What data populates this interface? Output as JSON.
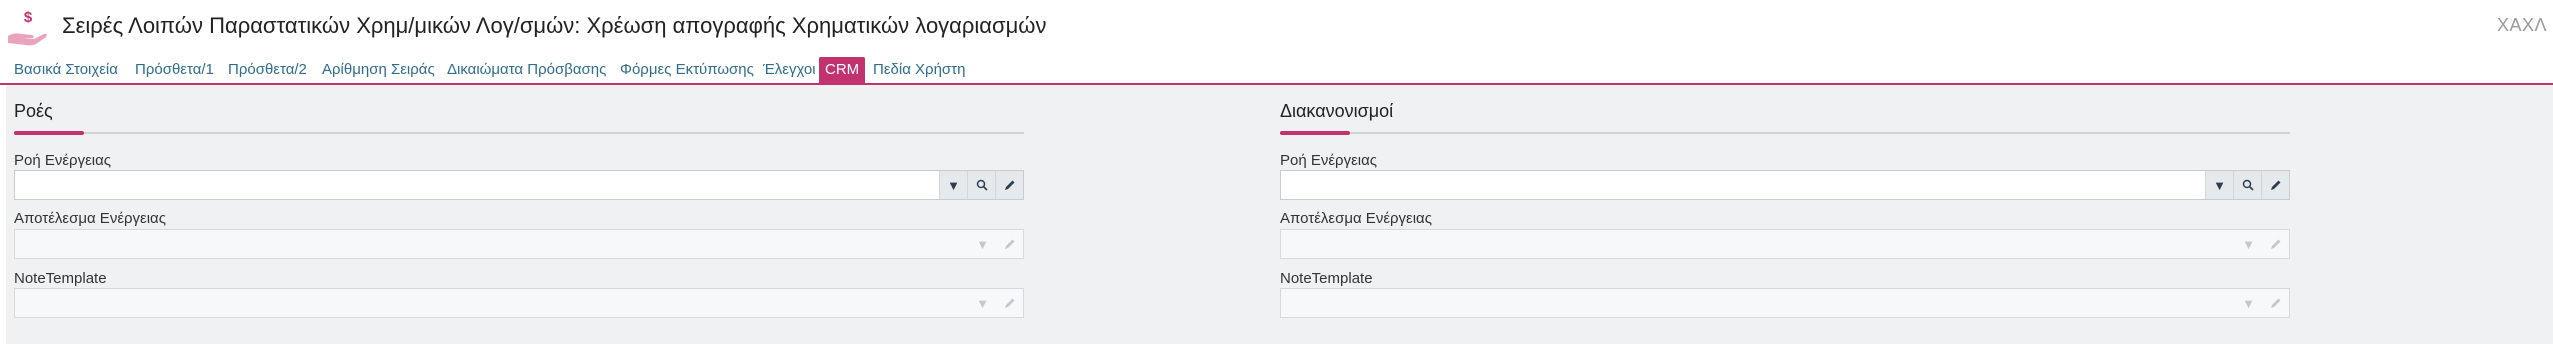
{
  "header": {
    "title": "Σειρές Λοιπών Παραστατικών Χρημ/μικών Λογ/σμών: Χρέωση απογραφής Χρηματικών λογαριασμών",
    "code": "ΧΑΧΛ",
    "icon": "money-hand-icon"
  },
  "tabs": [
    {
      "label": "Βασικά Στοιχεία"
    },
    {
      "label": "Πρόσθετα/1"
    },
    {
      "label": "Πρόσθετα/2"
    },
    {
      "label": "Αρίθμηση Σειράς"
    },
    {
      "label": "Δικαιώματα Πρόσβασης"
    },
    {
      "label": "Φόρμες Εκτύπωσης"
    },
    {
      "label": "Έλεγχοι"
    },
    {
      "label": "CRM",
      "active": true
    },
    {
      "label": "Πεδία Χρήστη"
    }
  ],
  "colors": {
    "accent": "#c2326e",
    "link": "#2f6c8f",
    "content_bg": "#eff1f3"
  },
  "panels": [
    {
      "title": "Ροές",
      "fields": [
        {
          "label": "Ροή Ενέργειας",
          "value": "",
          "enabled": true
        },
        {
          "label": "Αποτέλεσμα Ενέργειας",
          "value": "",
          "enabled": false
        },
        {
          "label": "NoteTemplate",
          "value": "",
          "enabled": false
        }
      ]
    },
    {
      "title": "Διακανονισμοί",
      "fields": [
        {
          "label": "Ροή Ενέργειας",
          "value": "",
          "enabled": true
        },
        {
          "label": "Αποτέλεσμα Ενέργειας",
          "value": "",
          "enabled": false
        },
        {
          "label": "NoteTemplate",
          "value": "",
          "enabled": false
        }
      ]
    }
  ]
}
